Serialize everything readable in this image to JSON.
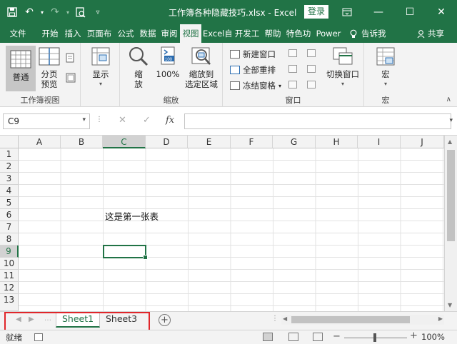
{
  "title": {
    "text": "工作簿各种隐藏技巧.xlsx  -  Excel",
    "login": "登录"
  },
  "tabs": [
    {
      "label": "文件"
    },
    {
      "label": "开始"
    },
    {
      "label": "插入"
    },
    {
      "label": "页面布"
    },
    {
      "label": "公式"
    },
    {
      "label": "数据"
    },
    {
      "label": "审阅"
    },
    {
      "label": "视图"
    },
    {
      "label": "Excel自"
    },
    {
      "label": "开发工"
    },
    {
      "label": "帮助"
    },
    {
      "label": "特色功"
    },
    {
      "label": "Power"
    }
  ],
  "tell_me": "告诉我",
  "share": "共享",
  "ribbon": {
    "workbook_views": {
      "label": "工作簿视图",
      "normal": "普通",
      "page_break_1": "分页",
      "page_break_2": "预览"
    },
    "show": {
      "label": "显示"
    },
    "zoom": {
      "label": "缩放",
      "zoom_1": "缩",
      "zoom_2": "放",
      "hundred": "100%",
      "to_sel_1": "缩放到",
      "to_sel_2": "选定区域"
    },
    "window": {
      "label": "窗口",
      "new_window": "新建窗口",
      "arrange_all": "全部重排",
      "freeze": "冻结窗格",
      "switch": "切换窗口"
    },
    "macros": {
      "label": "宏",
      "btn": "宏"
    }
  },
  "formula_bar": {
    "name_box": "C9",
    "formula": ""
  },
  "columns": [
    "A",
    "B",
    "C",
    "D",
    "E",
    "F",
    "G",
    "H",
    "I",
    "J"
  ],
  "rows": [
    "1",
    "2",
    "3",
    "4",
    "5",
    "6",
    "7",
    "8",
    "9",
    "10",
    "11",
    "12",
    "13"
  ],
  "selected_column": "C",
  "selected_row": "9",
  "cell_c6": "这是第一张表",
  "sheets": [
    {
      "name": "Sheet1",
      "active": true
    },
    {
      "name": "Sheet3",
      "active": false
    }
  ],
  "status": {
    "mode": "就绪",
    "zoom": "100%"
  },
  "colors": {
    "accent": "#217346",
    "highlight_box": "#e0262a"
  }
}
